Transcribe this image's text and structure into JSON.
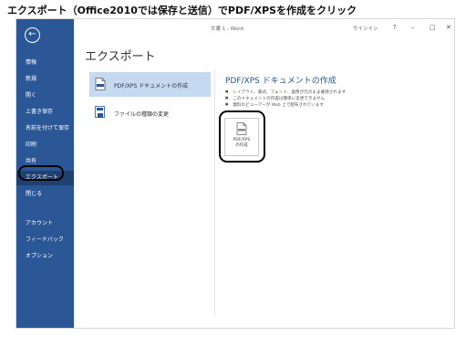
{
  "caption": "エクスポート（Office2010では保存と送信）でPDF/XPSを作成をクリック",
  "window": {
    "doc_title": "文書 1 - Word",
    "signin": "サインイン",
    "help": "?",
    "minimize": "–",
    "restore": "□",
    "close": "✕"
  },
  "sidebar": {
    "back": "←",
    "items": [
      {
        "label": "情報"
      },
      {
        "label": "新規"
      },
      {
        "label": "開く"
      },
      {
        "label": "上書き保存"
      },
      {
        "label": "名前を付けて保存"
      },
      {
        "label": "印刷"
      },
      {
        "label": "共有"
      },
      {
        "label": "エクスポート"
      },
      {
        "label": "閉じる"
      }
    ],
    "bottom_items": [
      {
        "label": "アカウント"
      },
      {
        "label": "フィードバック"
      },
      {
        "label": "オプション"
      }
    ]
  },
  "page_title": "エクスポート",
  "options": [
    {
      "label": "PDF/XPS ドキュメントの作成",
      "selected": true
    },
    {
      "label": "ファイルの種類の変更",
      "selected": false
    }
  ],
  "detail": {
    "title": "PDF/XPS ドキュメントの作成",
    "bullets": [
      "レイアウト、書式、フォント、画像が元のまま維持されます",
      "このドキュメントの内容は簡単に変更できません",
      "無料のビューアーが Web 上で配布されています"
    ],
    "button_label": "PDF/XPS\nの作成"
  },
  "colors": {
    "sidebar": "#2b5797",
    "sidebar_active": "#1f4172",
    "option_selected": "#c5d9f1",
    "detail_title": "#2b5797"
  }
}
